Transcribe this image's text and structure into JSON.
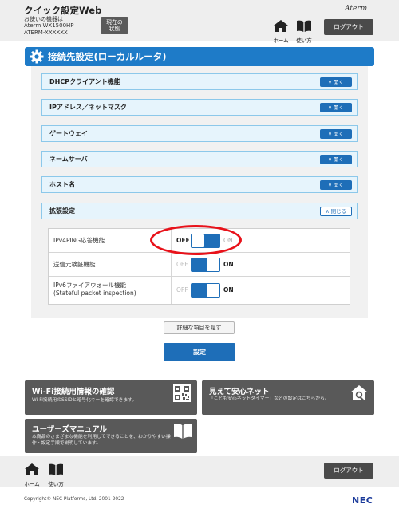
{
  "header": {
    "title": "クイック設定Web",
    "device_lines": [
      "お使いの機器は",
      "Aterm WX1500HP",
      "ATERM-XXXXXX"
    ],
    "status_button": [
      "現在の",
      "状態"
    ],
    "brand": "Aterm",
    "home_label": "ホーム",
    "help_label": "使い方",
    "logout_label": "ログアウト",
    "home_icon": "home-icon",
    "help_icon": "book-icon"
  },
  "section": {
    "title": "接続先設定(ローカルルータ)",
    "icon": "gear-icon"
  },
  "accordions": [
    {
      "label": "DHCPクライアント機能",
      "button": "開く",
      "open": false
    },
    {
      "label": "IPアドレス／ネットマスク",
      "button": "開く",
      "open": false
    },
    {
      "label": "ゲートウェイ",
      "button": "開く",
      "open": false
    },
    {
      "label": "ネームサーバ",
      "button": "開く",
      "open": false
    },
    {
      "label": "ホスト名",
      "button": "開く",
      "open": false
    },
    {
      "label": "拡張設定",
      "button": "閉じる",
      "open": true
    }
  ],
  "settings": [
    {
      "label": "IPv4PING応答機能",
      "label2": "",
      "off": "OFF",
      "on": "ON",
      "active": "off"
    },
    {
      "label": "送信元検証機能",
      "label2": "",
      "off": "OFF",
      "on": "ON",
      "active": "on"
    },
    {
      "label": "IPv6ファイアウォール機能",
      "label2": "(Stateful packet inspection)",
      "off": "OFF",
      "on": "ON",
      "active": "on"
    }
  ],
  "buttons": {
    "hide_details": "詳細な項目を隠す",
    "submit": "設定"
  },
  "cards": {
    "wifi": {
      "title": "Wi-Fi接続用情報の確認",
      "desc": "Wi-Fi接続用のSSIDと暗号化キーを確認できます。",
      "icon": "qr-code-icon"
    },
    "safety": {
      "title": "見えて安心ネット",
      "desc": "「こども安心ネットタイマー」などの設定はこちらから。",
      "icon": "home-search-icon"
    },
    "manual": {
      "title": "ユーザーズマニュアル",
      "desc_lines": [
        "本商品のさまざまな機能を利用してできることを、わかりやすい操",
        "作・設定手順で説明しています。"
      ],
      "icon": "book-icon"
    }
  },
  "footer": {
    "home_label": "ホーム",
    "help_label": "使い方",
    "logout_label": "ログアウト",
    "copyright": "Copyright© NEC Platforms, Ltd. 2001-2022",
    "logo": "NEC"
  },
  "colors": {
    "accent": "#1e7bc8",
    "button_blue": "#1e6eb8",
    "highlight": "#e8121a",
    "card_bg": "#595959"
  }
}
